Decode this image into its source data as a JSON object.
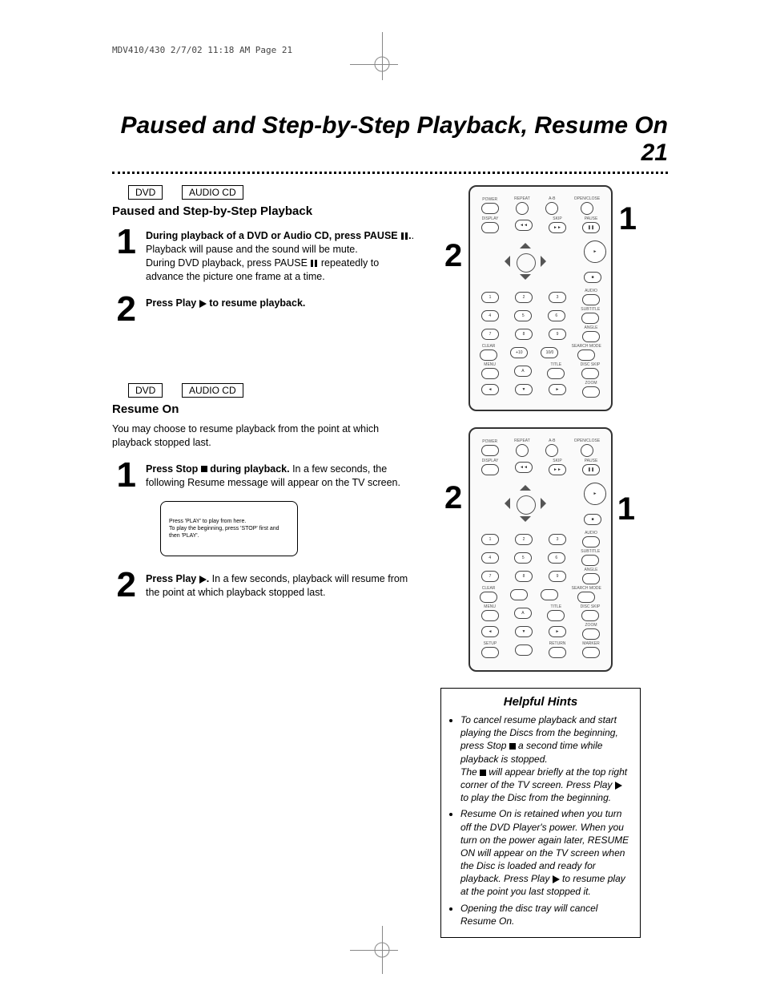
{
  "meta": {
    "print_header": "MDV410/430  2/7/02  11:18 AM  Page 21"
  },
  "page_title": "Paused and Step-by-Step Playback, Resume On  21",
  "tags": {
    "dvd": "DVD",
    "audio_cd": "AUDIO CD"
  },
  "section1": {
    "heading": "Paused and Step-by-Step Playback",
    "step1_a": "During playback of a DVD or Audio CD, press PAUSE",
    "step1_b": ". Playback will pause and the sound will be mute.",
    "step1_c": "During DVD playback, press PAUSE ",
    "step1_d": " repeatedly to advance the picture one frame at a time.",
    "step2_a": "Press Play ",
    "step2_b": " to resume playback."
  },
  "section2": {
    "heading": "Resume On",
    "intro": "You may choose to resume playback from the point at which playback stopped last.",
    "step1_a": "Press Stop ",
    "step1_b": " during playback.",
    "step1_c": " In a few seconds, the following Resume message will appear on the TV screen.",
    "msgbox": "Press 'PLAY' to play from here.\nTo play the beginning, press 'STOP' first and then 'PLAY'.",
    "step2_a": "Press Play ",
    "step2_b": ".",
    "step2_c": "  In a few seconds, playback will resume from the point at which playback stopped last."
  },
  "remote": {
    "labels_top": [
      "POWER",
      "REPEAT",
      "A-B",
      "OPEN/CLOSE"
    ],
    "labels_row2": [
      "DISPLAY",
      "",
      "SKIP",
      "PAUSE"
    ],
    "labels_side": [
      "AUDIO",
      "SUBTITLE",
      "ANGLE",
      "SEARCH MODE",
      "DISC SKIP",
      "ZOOM",
      "MARKER"
    ],
    "labels_bottom_row1": [
      "CLEAR",
      "+10",
      "10/0",
      ""
    ],
    "labels_bottom_row2": [
      "MENU",
      "TITLE",
      "",
      ""
    ],
    "labels_bottom_row3": [
      "",
      "",
      "",
      ""
    ],
    "labels_setup": [
      "SETUP",
      "",
      "RETURN",
      ""
    ],
    "num": [
      "1",
      "2",
      "3",
      "4",
      "5",
      "6",
      "7",
      "8",
      "9"
    ],
    "nav": [
      "◄◄",
      "►►",
      "■",
      "A",
      "►",
      "▼"
    ]
  },
  "callouts": {
    "one": "1",
    "two": "2"
  },
  "hints": {
    "title": "Helpful Hints",
    "items": [
      {
        "a": "To cancel resume playback and start playing the Discs from the beginning, press Stop ",
        "b": " a second time while playback is stopped.",
        "c": "The ",
        "d": " will appear briefly at the top right corner of the TV screen. Press Play ",
        "e": " to play the Disc from the beginning."
      },
      {
        "a": "Resume On is retained when you turn off the DVD Player's power. When you turn on the power again later, RESUME ON will appear on the TV screen when the Disc is loaded and ready for playback. Press Play ",
        "b": " to resume play at the point you last stopped it."
      },
      {
        "a": "Opening the disc tray will cancel Resume On."
      }
    ]
  }
}
